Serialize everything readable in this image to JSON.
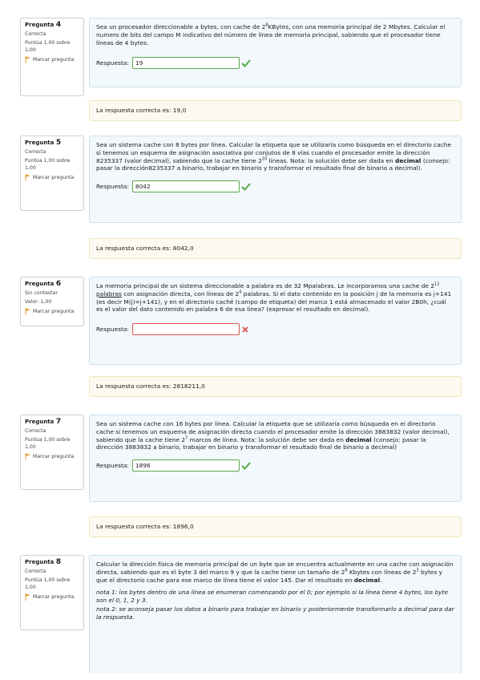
{
  "common": {
    "flag_label": "Marcar pregunta",
    "answer_label": "Respuesta:"
  },
  "questions": [
    {
      "number": "4",
      "prefix": "Pregunta",
      "state": "Correcta",
      "score": "Puntúa 1,00 sobre 1,00",
      "text": [
        "Sea un procesador direccionable a bytes, con cache de 2",
        "8",
        "KBytes, con una memoria principal de 2",
        "Mbytes. Calcular el numero de bits del campo M indicativo del número de línea de memoria principal, sabiendo que el procesador tiene líneas de 4 bytes."
      ],
      "answer": "19",
      "result": "correct",
      "feedback": "La respuesta correcta es: 19,0"
    },
    {
      "number": "5",
      "prefix": "Pregunta",
      "state": "Correcta",
      "score": "Puntúa 1,00 sobre 1,00",
      "text_parts": {
        "a": "Sea un sistema cache con 8 bytes por línea. Calcular la etiqueta que se utilizaría como búsqueda en el directorio cache si tenemos un esquema de asignación asociativa por conjutos de 8 vías cuando el procesador emite la dirección 8235337 (valor decimal), sabiendo que la cache tiene 2",
        "sup": "10",
        "b": " líneas. Nota: la solución debe ser dada en ",
        "bold": "decimal",
        "c": " (consejo: pasar la dirección8235337 a binario, trabajar en binario y transformar el resultado final de binario a decimal)."
      },
      "answer": "8042",
      "result": "correct",
      "feedback": "La respuesta correcta es: 8042,0"
    },
    {
      "number": "6",
      "prefix": "Pregunta",
      "state": "Sin contestar",
      "score": "Valor: 1,00",
      "text_parts": {
        "a": "La memoria principal de un sistema direccionable a palabra es de 32 Mpalabras. Le incorporamos una cache de 2",
        "sup1": "12",
        "u": "palabras",
        "b": " con asignación directa, con líneas de 2",
        "sup2": "4",
        "c": " palabras. Si el dato contenido en la posición j de la memoria es j+141 (es decir M(j)=j+141), y en el directorio caché (campo de etiqueta) del marco 1 está almacenado el valor 2B0h, ¿cuál es el valor del dato contenido en palabra 6 de esa línea? (expresar el resultado en decimal)."
      },
      "answer": "",
      "result": "incorrect",
      "feedback": "La respuesta correcta es: 2818211,0"
    },
    {
      "number": "7",
      "prefix": "Pregunta",
      "state": "Correcta",
      "score": "Puntúa 1,00 sobre 1,00",
      "text_parts": {
        "a": "Sea un sistema cache con 16 bytes por línea. Calcular la etiqueta que se utilizaría como búsqueda en el directorio cache si tenemos un esquema de asignación directa cuando el procesador emite la dirección 3883832 (valor decimal), sabiendo que la cache tiene 2",
        "sup": "7",
        "b": " marcos de línea. Nota: la solución debe ser dada en ",
        "bold": "decimal",
        "c": " (consejo: pasar la dirección 3883832 a binario, trabajar en binario y transformar el resultado final de binario a decimal)"
      },
      "answer": "1896",
      "result": "correct",
      "feedback": "La respuesta correcta es: 1896,0"
    },
    {
      "number": "8",
      "prefix": "Pregunta",
      "state": "Correcta",
      "score": "Puntúa 1,00 sobre 1,00",
      "text_parts": {
        "a": "Calcular la dirección física de memoria principal de un byte que se encuentra actualmente en una cache con asignación directa, sabiendo que es el byte 3 del marco 9 y que la cache tiene un tamaño de 2",
        "sup1": "8",
        "b": " Kbytes con líneas de 2",
        "sup2": "3",
        "c": " bytes y que el directorio cache para ese marco de línea tiene el valor 145. Dar el resultado en ",
        "bold": "decimal",
        "d": "."
      },
      "note1": "nota 1: los bytes dentro de una línea se enumeran comenzando por el 0; por ejemplo si la línea tiene 4 bytes, los byte son el 0, 1, 2 y 3.",
      "note2": "nota 2: se aconseja pasar los datos a binario para trabajar en binario y posteriormente transformarlo a decimal para dar la respuesta."
    }
  ],
  "colors": {
    "correct": "#5aa84a",
    "incorrect": "#d9534f",
    "flag": "#e8a33c"
  }
}
